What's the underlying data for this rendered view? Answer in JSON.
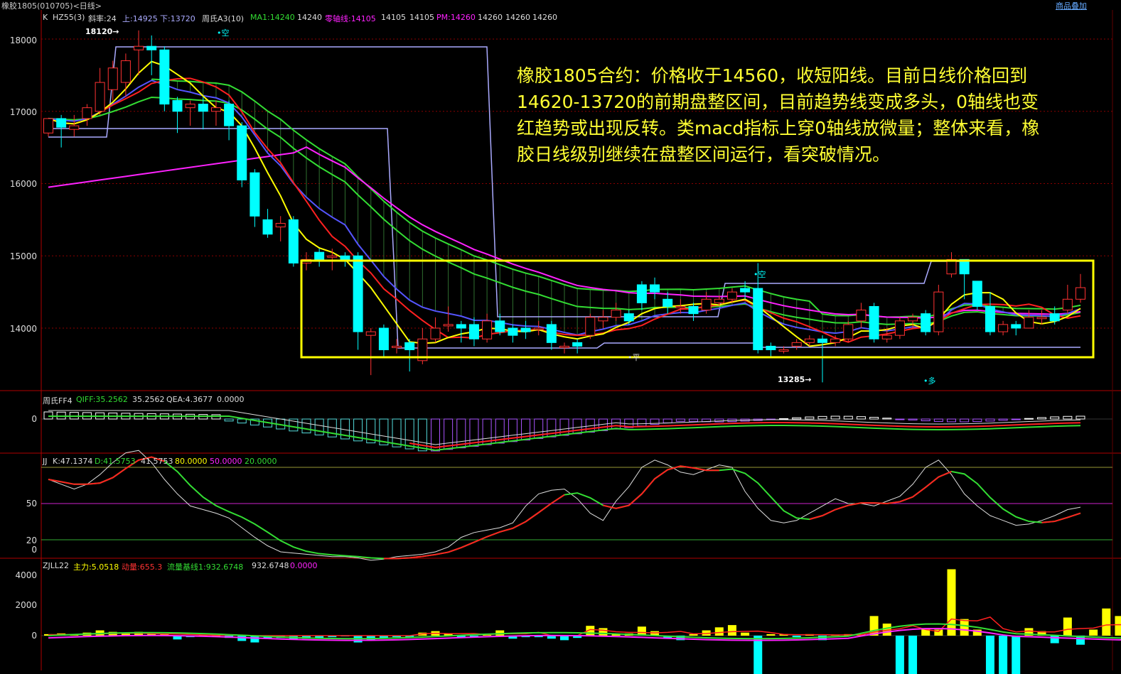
{
  "window": {
    "title": "橡胶1805(010705)<日线>",
    "menu_link": "商品叠加"
  },
  "note": {
    "line1": "橡胶1805合约：价格收于14560，收短阳线。目前日线价格回到",
    "line2": "14620-13720的前期盘整区间，目前趋势线变成多头，0轴线也变",
    "line3": "红趋势或出现反转。类macd指标上穿0轴线放微量；整体来看，橡",
    "line4": "胶日线级别继续在盘整区间运行，看突破情况。"
  },
  "panels": {
    "main": {
      "header": [
        "K",
        "HZ55(3)",
        "斜率:24",
        "上:14925",
        "下:13720",
        "周氏A3(10)",
        "MA1:14240",
        "14240",
        "零轴线:14105",
        "14105",
        "14105",
        "PM:14260",
        "14260",
        "14260",
        "14260"
      ],
      "y_ticks": [
        "18000",
        "17000",
        "16000",
        "15000",
        "14000"
      ],
      "annotations": {
        "high": "18120→",
        "low": "13285→",
        "kong1": "•空",
        "kong2": "•空",
        "ping": "•平",
        "duo": "•多"
      }
    },
    "ff4": {
      "header": [
        "周氏FF4",
        "QIFF:35.2562",
        "35.2562",
        "QEA:4.3677",
        "0.0000"
      ],
      "y_ticks": [
        "0"
      ]
    },
    "jj": {
      "header": [
        "JJ",
        "K:47.1374",
        "D:41.5753",
        "41.5753",
        "80.0000",
        "50.0000",
        "20.0000"
      ],
      "y_ticks": [
        "50",
        "20",
        "0"
      ]
    },
    "zjll": {
      "header": [
        "ZJLL22",
        "主力:5.0518",
        "动量:655.3",
        "流量基线1:932.6748",
        "932.6748",
        "0.0000"
      ],
      "y_ticks": [
        "4000",
        "2000",
        "0"
      ]
    }
  },
  "colors": {
    "up": "#ff3232",
    "down": "#00ffff",
    "ma_yellow": "#ffff00",
    "ma_red": "#ff2020",
    "ma_blue": "#5555ff",
    "ma_green": "#33dd33",
    "ma_magenta": "#ff22ff",
    "band": "#aaaaff",
    "box": "#ffff00",
    "grid": "#8b0000"
  },
  "chart_data": [
    {
      "type": "candlestick",
      "ylim": [
        13200,
        18200
      ],
      "candles": [
        [
          16700,
          16900,
          16650,
          16850
        ],
        [
          16900,
          16780,
          16500,
          16950
        ],
        [
          16750,
          16800,
          16650,
          16950
        ],
        [
          16900,
          17050,
          16800,
          17100
        ],
        [
          17000,
          17400,
          16950,
          17600
        ],
        [
          17300,
          17600,
          17150,
          17700
        ],
        [
          17400,
          17700,
          17200,
          17800
        ],
        [
          17850,
          17900,
          17500,
          18120
        ],
        [
          17900,
          17850,
          17500,
          18050
        ],
        [
          17850,
          17100,
          17000,
          17900
        ],
        [
          17150,
          17000,
          16700,
          17200
        ],
        [
          17050,
          17100,
          16800,
          17150
        ],
        [
          17100,
          17000,
          16750,
          17200
        ],
        [
          17000,
          17050,
          16800,
          17150
        ],
        [
          17100,
          16800,
          16600,
          17150
        ],
        [
          16800,
          16050,
          15950,
          16850
        ],
        [
          16150,
          15550,
          15400,
          16200
        ],
        [
          15500,
          15300,
          15250,
          15650
        ],
        [
          15400,
          15450,
          15200,
          15550
        ],
        [
          15500,
          14900,
          14850,
          15550
        ],
        [
          14900,
          14950,
          14800,
          15050
        ],
        [
          15050,
          14950,
          14850,
          15100
        ],
        [
          15000,
          15000,
          14800,
          15100
        ],
        [
          15000,
          14950,
          14850,
          15050
        ],
        [
          15000,
          13950,
          13700,
          15050
        ],
        [
          13900,
          13950,
          13350,
          14000
        ],
        [
          14000,
          13700,
          13600,
          14050
        ],
        [
          13750,
          13750,
          13650,
          13850
        ],
        [
          13800,
          13700,
          13400,
          13850
        ],
        [
          13550,
          13850,
          13500,
          14000
        ],
        [
          13850,
          14000,
          13800,
          14150
        ],
        [
          14050,
          14050,
          13950,
          14300
        ],
        [
          14050,
          14000,
          13800,
          14100
        ],
        [
          14050,
          13850,
          13750,
          14150
        ],
        [
          13850,
          14100,
          13800,
          14200
        ],
        [
          14100,
          13950,
          13900,
          14200
        ],
        [
          14000,
          13900,
          13800,
          14050
        ],
        [
          14000,
          13950,
          13850,
          14100
        ],
        [
          14000,
          14000,
          13900,
          14100
        ],
        [
          14050,
          13800,
          13700,
          14100
        ],
        [
          13750,
          13750,
          13650,
          13800
        ],
        [
          13800,
          13750,
          13650,
          13850
        ],
        [
          13900,
          14150,
          13850,
          14200
        ],
        [
          14100,
          14150,
          14000,
          14250
        ],
        [
          14150,
          14250,
          14100,
          14350
        ],
        [
          14200,
          14100,
          14050,
          14250
        ],
        [
          14600,
          14350,
          14250,
          14650
        ],
        [
          14600,
          14500,
          14400,
          14700
        ],
        [
          14400,
          14300,
          14200,
          14500
        ],
        [
          14300,
          14300,
          14200,
          14400
        ],
        [
          14300,
          14200,
          14100,
          14350
        ],
        [
          14250,
          14400,
          14200,
          14500
        ],
        [
          14350,
          14400,
          14300,
          14450
        ],
        [
          14400,
          14500,
          14350,
          14550
        ],
        [
          14550,
          14500,
          14400,
          14650
        ],
        [
          14550,
          13700,
          13650,
          14900
        ],
        [
          13750,
          13700,
          13600,
          13800
        ],
        [
          13700,
          13700,
          13650,
          13750
        ],
        [
          13750,
          13800,
          13700,
          13850
        ],
        [
          13800,
          13850,
          13750,
          13900
        ],
        [
          13850,
          13800,
          13250,
          13900
        ],
        [
          13800,
          13850,
          13750,
          13900
        ],
        [
          13850,
          14050,
          13800,
          14100
        ],
        [
          14100,
          14250,
          14000,
          14350
        ],
        [
          14300,
          13850,
          13800,
          14350
        ],
        [
          13850,
          13900,
          13800,
          14000
        ],
        [
          13900,
          14100,
          13850,
          14150
        ],
        [
          14100,
          14150,
          14000,
          14200
        ],
        [
          14200,
          13950,
          13900,
          14250
        ],
        [
          13950,
          14500,
          13900,
          14600
        ],
        [
          14750,
          14950,
          14700,
          15050
        ],
        [
          14950,
          14750,
          14400,
          14950
        ],
        [
          14650,
          14300,
          14250,
          14650
        ],
        [
          14300,
          13950,
          13900,
          14500
        ],
        [
          13950,
          14050,
          13900,
          14100
        ],
        [
          14050,
          14000,
          13900,
          14100
        ],
        [
          14000,
          14150,
          14000,
          14250
        ],
        [
          14150,
          14150,
          14050,
          14250
        ],
        [
          14200,
          14100,
          14050,
          14300
        ],
        [
          14250,
          14400,
          14200,
          14600
        ],
        [
          14400,
          14560,
          14350,
          14750
        ]
      ]
    },
    {
      "type": "line",
      "name": "ZJLL22",
      "ylim": [
        -4000,
        4500
      ],
      "values": [
        100,
        150,
        100,
        200,
        350,
        250,
        200,
        250,
        150,
        100,
        -250,
        -100,
        50,
        0,
        -150,
        -350,
        -450,
        -200,
        -150,
        -250,
        -200,
        -150,
        -100,
        -50,
        -450,
        -300,
        -200,
        -100,
        -150,
        200,
        300,
        150,
        -150,
        -100,
        50,
        350,
        -200,
        -100,
        -100,
        -200,
        -300,
        -150,
        650,
        500,
        100,
        150,
        600,
        300,
        -200,
        -300,
        100,
        350,
        550,
        700,
        200,
        -2800,
        100,
        100,
        -100,
        100,
        -300,
        50,
        100,
        100,
        1300,
        800,
        -4000,
        -4000,
        500,
        400,
        4400,
        1100,
        400,
        -3000,
        -4000,
        -4000,
        500,
        300,
        -500,
        1200,
        -600,
        400,
        1800,
        1300,
        900
      ]
    }
  ]
}
